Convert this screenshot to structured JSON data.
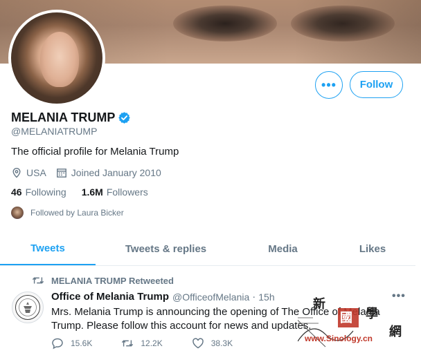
{
  "profile": {
    "name": "MELANIA TRUMP",
    "handle": "@MELANIATRUMP",
    "bio": "The official profile for Melania Trump",
    "location": "USA",
    "joined": "Joined January 2010",
    "following_count": "46",
    "following_label": "Following",
    "followers_count": "1.6M",
    "followers_label": "Followers",
    "followed_by": "Followed by Laura Bicker",
    "verified": true
  },
  "header_buttons": {
    "more_label": "•••",
    "follow_label": "Follow"
  },
  "tabs": [
    {
      "label": "Tweets",
      "active": true
    },
    {
      "label": "Tweets & replies",
      "active": false
    },
    {
      "label": "Media",
      "active": false
    },
    {
      "label": "Likes",
      "active": false
    }
  ],
  "tweet": {
    "retweet_label": "MELANIA TRUMP Retweeted",
    "author_name": "Office of Melania Trump",
    "author_handle": "@OfficeofMelania",
    "separator": "·",
    "time": "15h",
    "text": "Mrs. Melania Trump is announcing the opening of The Office of Melania Trump. Please follow this account for news and updates.",
    "more_label": "•••",
    "replies": "15.6K",
    "retweets": "12.2K",
    "likes": "38.3K"
  },
  "watermark": {
    "url": "www.Sinology.cn",
    "chars": [
      "新",
      "國",
      "學",
      "網"
    ]
  },
  "colors": {
    "accent": "#1da1f2",
    "text": "#14171a",
    "muted": "#657786"
  }
}
